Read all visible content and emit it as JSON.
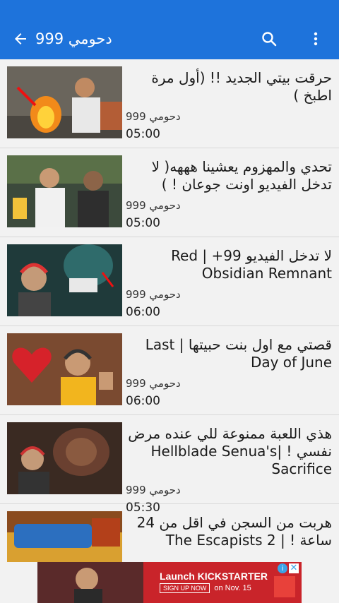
{
  "appbar": {
    "title": "دحومي 999"
  },
  "videos": [
    {
      "title": "حرقت بيتي الجديد !! (أول مرة اطبخ )",
      "channel": "دحومي 999",
      "duration": "05:00"
    },
    {
      "title": "تحدي والمهزوم يعشينا هههه( لا تدخل الفيديو اونت جوعان ! )",
      "channel": "دحومي 999",
      "duration": "05:00"
    },
    {
      "title": "لا تدخل الفيديو 99+ | Red Obsidian Remnant",
      "channel": "دحومي 999",
      "duration": "06:00"
    },
    {
      "title": "قصتي مع اول بنت حبيتها | Last Day of June",
      "channel": "دحومي 999",
      "duration": "06:00"
    },
    {
      "title": "هذي اللعبة ممنوعة للي عنده مرض نفسي ! |Hellblade Senua's Sacrifice",
      "channel": "دحومي 999",
      "duration": "05:30"
    },
    {
      "title": "هربت من السجن في اقل من 24 ساعة ! | The Escapists 2",
      "channel": "",
      "duration": ""
    }
  ],
  "ad": {
    "headline": "Launch KICKSTARTER",
    "cta": "SIGN UP NOW",
    "date": "on Nov. 15"
  },
  "colors": {
    "appbar": "#1e73db",
    "ad": "#c9242a"
  }
}
